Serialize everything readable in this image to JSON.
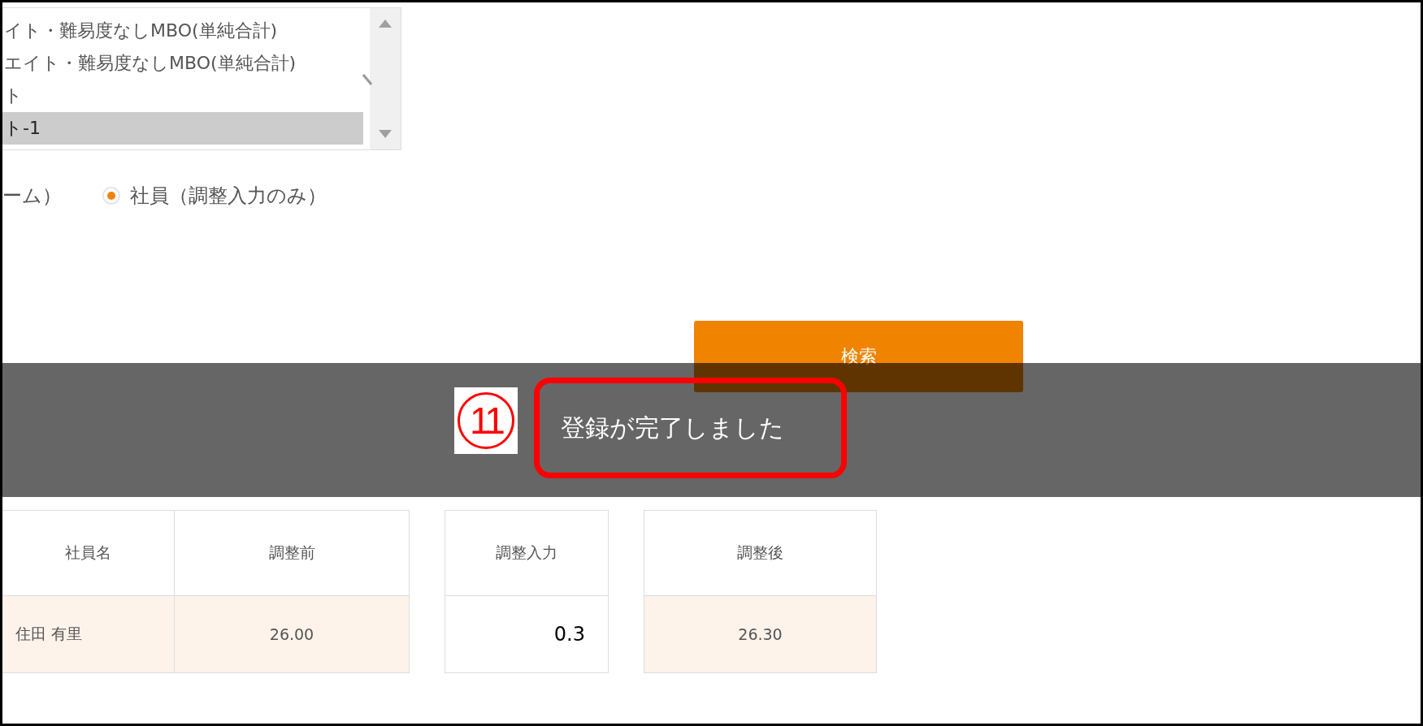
{
  "listbox": {
    "items": [
      {
        "label": "イト・難易度なしMBO(単純合計)",
        "selected": false
      },
      {
        "label": "エイト・難易度なしMBO(単純合計)",
        "selected": false
      },
      {
        "label": "ト",
        "selected": false
      },
      {
        "label": "ト-1",
        "selected": true
      }
    ]
  },
  "radios": [
    {
      "label": "ーム）",
      "selected": false
    },
    {
      "label": "社員（調整入力のみ）",
      "selected": true
    }
  ],
  "search_button": "検索",
  "toast": {
    "message": "登録が完了しました",
    "annotation": "11"
  },
  "tables": [
    {
      "columns": [
        "社員名",
        "調整前"
      ],
      "rows": [
        [
          {
            "text": "住田 有里",
            "kind": "name"
          },
          {
            "text": "26.00",
            "kind": "value"
          }
        ]
      ]
    },
    {
      "columns": [
        "調整入力"
      ],
      "rows": [
        [
          {
            "text": "0.3",
            "kind": "input"
          }
        ]
      ]
    },
    {
      "columns": [
        "調整後"
      ],
      "rows": [
        [
          {
            "text": "26.30",
            "kind": "value"
          }
        ]
      ]
    }
  ]
}
